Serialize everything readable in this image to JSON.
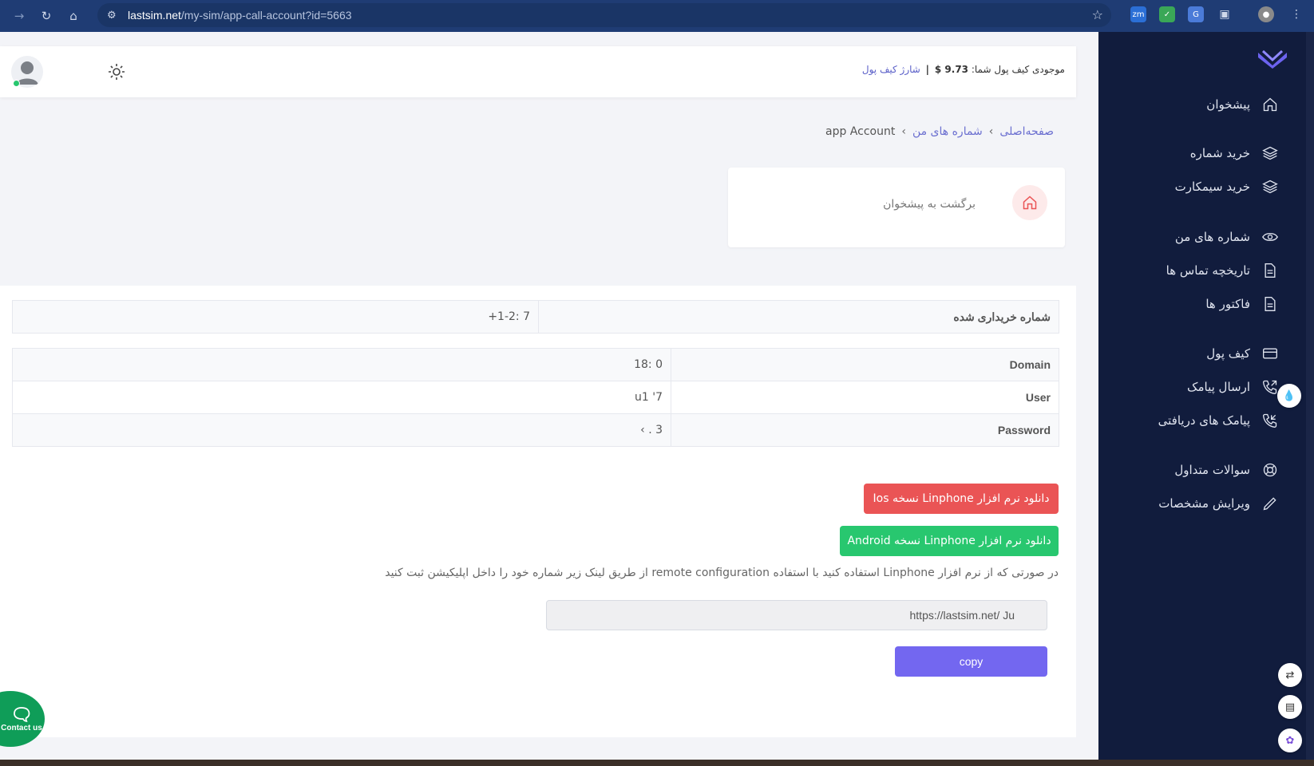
{
  "browser": {
    "url_host": "lastsim.net",
    "url_path": "/my-sim/app-call-account?id=5663"
  },
  "header": {
    "wallet_label": "موجودی کیف پول شما:",
    "wallet_amount": "9.73 $",
    "wallet_sep": "|",
    "wallet_charge_link": "شارژ کیف پول"
  },
  "sidebar": {
    "items": [
      {
        "label": "پیشخوان",
        "icon": "home-icon"
      },
      {
        "label": "خرید شماره",
        "icon": "layers-icon"
      },
      {
        "label": "خرید سیمکارت",
        "icon": "layers-icon"
      },
      {
        "label": "شماره های من",
        "icon": "eye-icon"
      },
      {
        "label": "تاریخچه تماس ها",
        "icon": "file-icon"
      },
      {
        "label": "فاکتور ها",
        "icon": "file-icon"
      },
      {
        "label": "کیف پول",
        "icon": "card-icon"
      },
      {
        "label": "ارسال پیامک",
        "icon": "phone-outgoing-icon"
      },
      {
        "label": "پیامک های دریافتی",
        "icon": "phone-incoming-icon"
      },
      {
        "label": "سوالات متداول",
        "icon": "lifebuoy-icon"
      },
      {
        "label": "ویرایش مشخصات",
        "icon": "pen-icon"
      }
    ]
  },
  "breadcrumb": {
    "home": "صفحه‌اصلی",
    "sep": "›",
    "my_numbers": "شماره های من",
    "current": "app Account"
  },
  "back_card": {
    "label": "برگشت به پیشخوان"
  },
  "purchased": {
    "label": "شماره خریداری شده",
    "value": "+1-2:          7"
  },
  "account": {
    "domain_label": "Domain",
    "domain_value": "18:          0",
    "user_label": "User",
    "user_value": "u1         '7",
    "password_label": "Password",
    "password_value": "‹    .    3"
  },
  "buttons": {
    "ios": "دانلود نرم افزار Linphone نسخه Ios",
    "android": "دانلود نرم افزار Linphone نسخه Android",
    "copy": "copy"
  },
  "hint": "در صورتی که از نرم افزار Linphone استفاده کنید با استفاده remote configuration از طریق لینک زیر شماره خود را داخل اپلیکیشن ثبت کنید",
  "remote_link": "https://lastsim.net/                              Ju",
  "contact": "Contact us"
}
